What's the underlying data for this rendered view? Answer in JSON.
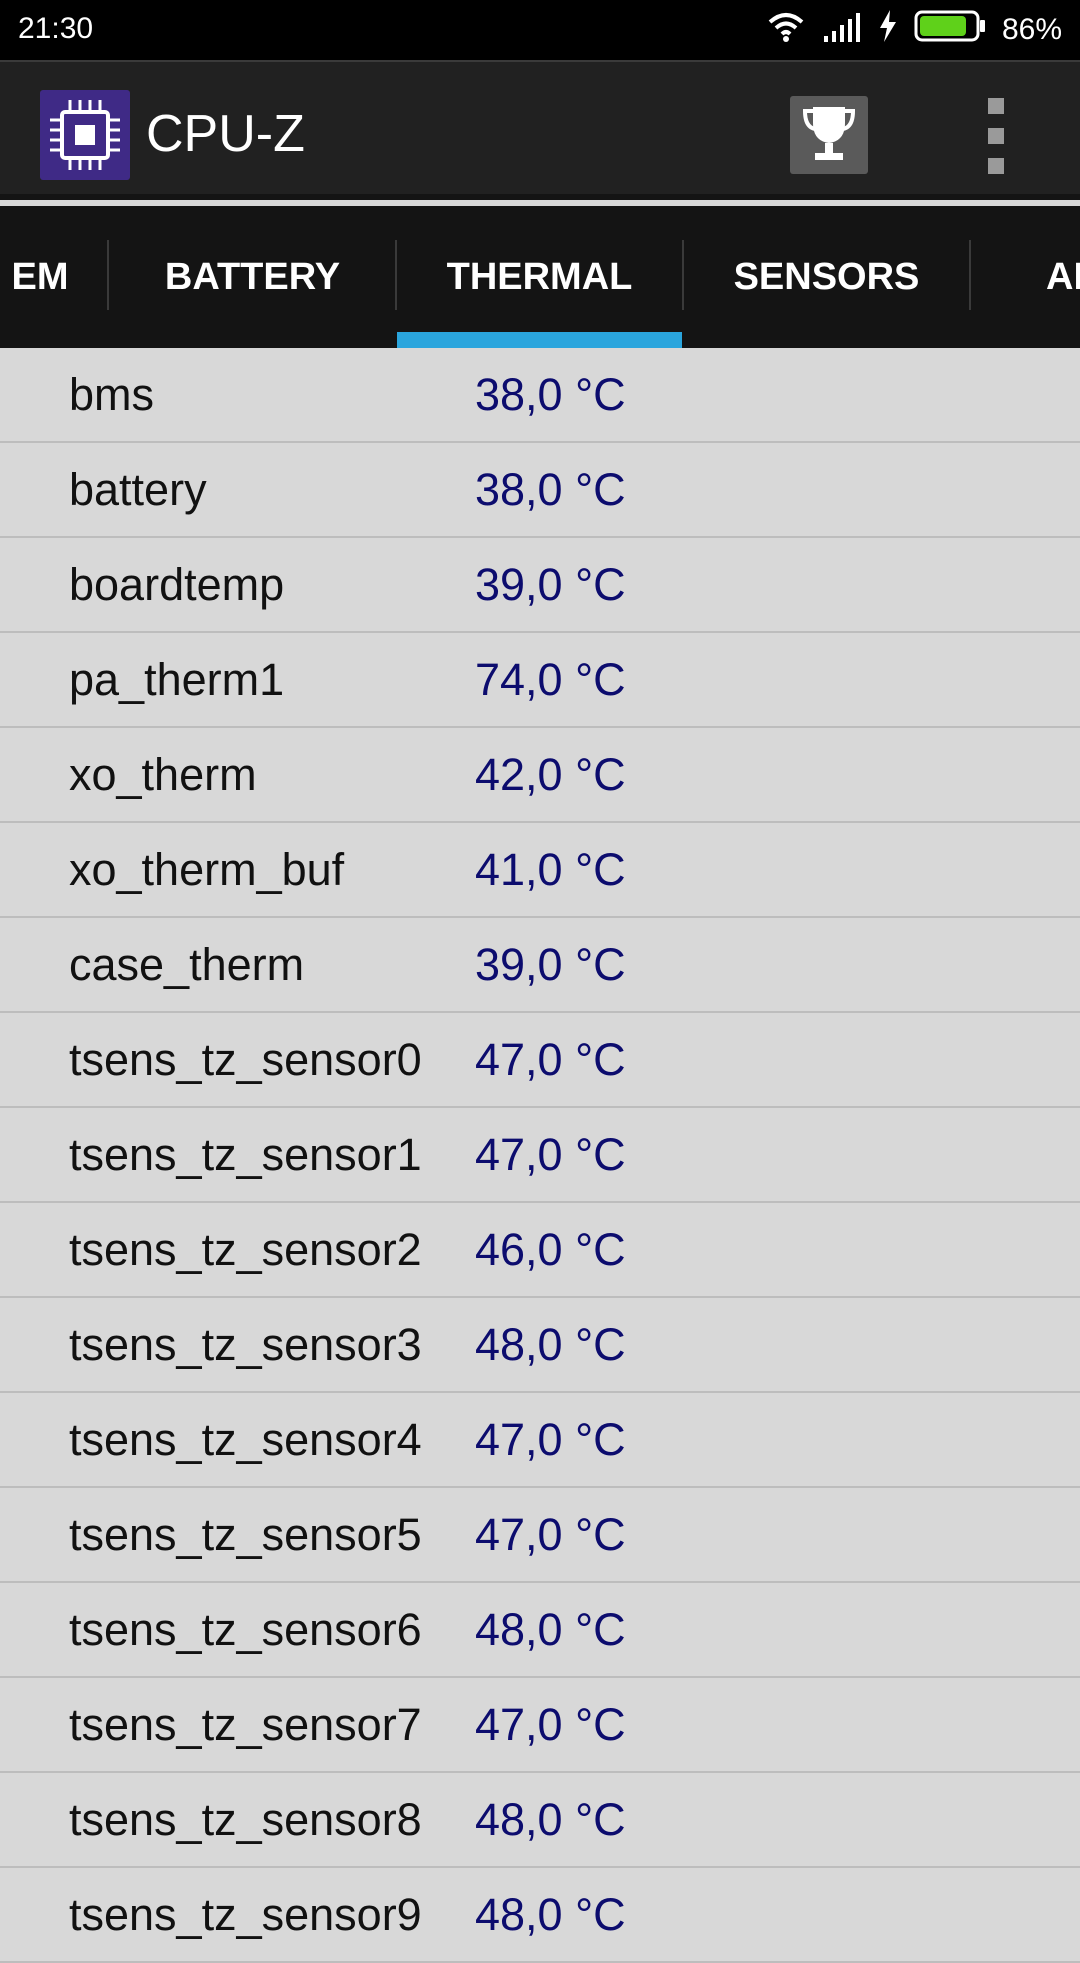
{
  "status_bar": {
    "time": "21:30",
    "battery_percent": "86%",
    "battery_level": 0.86,
    "icons": [
      "wifi-icon",
      "signal-icon",
      "charging-icon",
      "battery-icon"
    ]
  },
  "app_bar": {
    "title": "CPU-Z",
    "icons": [
      "cpu-chip-icon",
      "trophy-icon",
      "overflow-menu-icon"
    ]
  },
  "tabs": [
    {
      "label": "EM",
      "selected": false
    },
    {
      "label": "BATTERY",
      "selected": false
    },
    {
      "label": "THERMAL",
      "selected": true
    },
    {
      "label": "SENSORS",
      "selected": false
    },
    {
      "label": "AI",
      "selected": false
    }
  ],
  "thermal": [
    {
      "name": "bms",
      "value": "38,0 °C"
    },
    {
      "name": "battery",
      "value": "38,0 °C"
    },
    {
      "name": "boardtemp",
      "value": "39,0 °C"
    },
    {
      "name": "pa_therm1",
      "value": "74,0 °C"
    },
    {
      "name": "xo_therm",
      "value": "42,0 °C"
    },
    {
      "name": "xo_therm_buf",
      "value": "41,0 °C"
    },
    {
      "name": "case_therm",
      "value": "39,0 °C"
    },
    {
      "name": "tsens_tz_sensor0",
      "value": "47,0 °C"
    },
    {
      "name": "tsens_tz_sensor1",
      "value": "47,0 °C"
    },
    {
      "name": "tsens_tz_sensor2",
      "value": "46,0 °C"
    },
    {
      "name": "tsens_tz_sensor3",
      "value": "48,0 °C"
    },
    {
      "name": "tsens_tz_sensor4",
      "value": "47,0 °C"
    },
    {
      "name": "tsens_tz_sensor5",
      "value": "47,0 °C"
    },
    {
      "name": "tsens_tz_sensor6",
      "value": "48,0 °C"
    },
    {
      "name": "tsens_tz_sensor7",
      "value": "47,0 °C"
    },
    {
      "name": "tsens_tz_sensor8",
      "value": "48,0 °C"
    },
    {
      "name": "tsens_tz_sensor9",
      "value": "48,0 °C"
    }
  ],
  "colors": {
    "accent": "#2aa5dd",
    "value_text": "#0c0c6e",
    "app_icon_bg": "#3f2a86",
    "battery_fill": "#5fd11a"
  }
}
